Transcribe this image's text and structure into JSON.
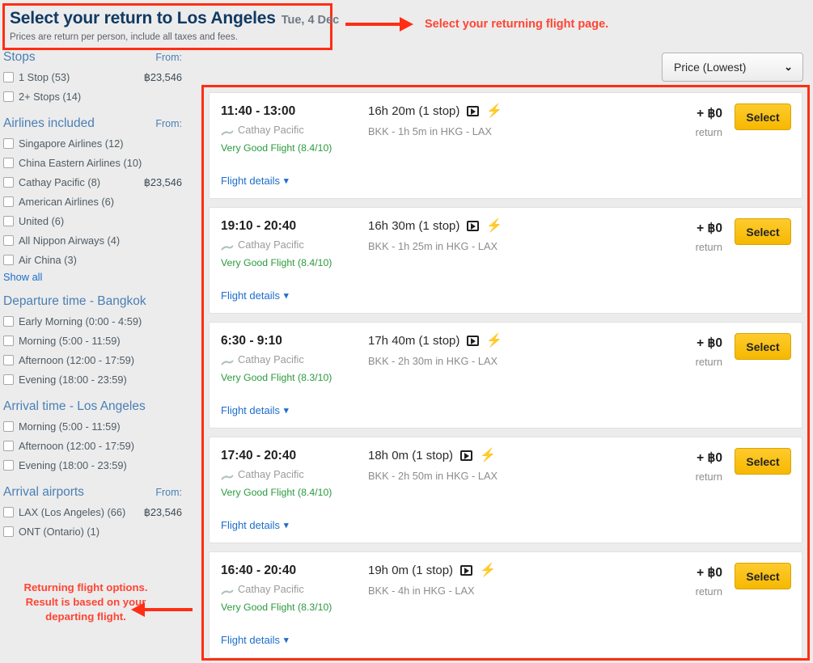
{
  "header": {
    "title": "Select your return to Los Angeles",
    "date": "Tue, 4 Dec",
    "subtitle": "Prices are return per person, include all taxes and fees."
  },
  "annotations": {
    "top": "Select your returning flight page.",
    "left": "Returning flight options. Result is based on your departing flight.",
    "box_color": "#ff2e14",
    "text_color": "#ff4433"
  },
  "sort": {
    "label": "Price (Lowest)",
    "chevron": "chevron-down-icon"
  },
  "sidebar": {
    "groups": [
      {
        "title": "Stops",
        "from_label": "From:",
        "options": [
          {
            "label": "1 Stop (53)",
            "price": "฿23,546",
            "checked": false
          },
          {
            "label": "2+ Stops (14)",
            "price": "",
            "checked": false
          }
        ]
      },
      {
        "title": "Airlines included",
        "from_label": "From:",
        "options": [
          {
            "label": "Singapore Airlines (12)",
            "price": "",
            "checked": false
          },
          {
            "label": "China Eastern Airlines (10)",
            "price": "",
            "checked": false
          },
          {
            "label": "Cathay Pacific (8)",
            "price": "฿23,546",
            "checked": false
          },
          {
            "label": "American Airlines (6)",
            "price": "",
            "checked": false
          },
          {
            "label": "United (6)",
            "price": "",
            "checked": false
          },
          {
            "label": "All Nippon Airways (4)",
            "price": "",
            "checked": false
          },
          {
            "label": "Air China (3)",
            "price": "",
            "checked": false
          }
        ],
        "show_all": "Show all"
      },
      {
        "title": "Departure time - Bangkok",
        "from_label": "",
        "options": [
          {
            "label": "Early Morning (0:00 - 4:59)",
            "price": "",
            "checked": false
          },
          {
            "label": "Morning (5:00 - 11:59)",
            "price": "",
            "checked": false
          },
          {
            "label": "Afternoon (12:00 - 17:59)",
            "price": "",
            "checked": false
          },
          {
            "label": "Evening (18:00 - 23:59)",
            "price": "",
            "checked": false
          }
        ]
      },
      {
        "title": "Arrival time - Los Angeles",
        "from_label": "",
        "options": [
          {
            "label": "Morning (5:00 - 11:59)",
            "price": "",
            "checked": false
          },
          {
            "label": "Afternoon (12:00 - 17:59)",
            "price": "",
            "checked": false
          },
          {
            "label": "Evening (18:00 - 23:59)",
            "price": "",
            "checked": false
          }
        ]
      },
      {
        "title": "Arrival airports",
        "from_label": "From:",
        "options": [
          {
            "label": "LAX (Los Angeles) (66)",
            "price": "฿23,546",
            "checked": false
          },
          {
            "label": "ONT (Ontario) (1)",
            "price": "",
            "checked": false
          }
        ]
      }
    ]
  },
  "results": {
    "select_label": "Select",
    "details_label": "Flight details",
    "details_chevron": "chevron-down-icon",
    "return_label": "return",
    "icons": [
      "entertainment-screen-icon",
      "power-outlet-icon"
    ],
    "flights": [
      {
        "times": "11:40 - 13:00",
        "airline": "Cathay Pacific",
        "rating": "Very Good Flight (8.4/10)",
        "duration": "16h 20m (1 stop)",
        "route": "BKK - 1h 5m in HKG - LAX",
        "price": "+ ฿0"
      },
      {
        "times": "19:10 - 20:40",
        "airline": "Cathay Pacific",
        "rating": "Very Good Flight (8.4/10)",
        "duration": "16h 30m (1 stop)",
        "route": "BKK - 1h 25m in HKG - LAX",
        "price": "+ ฿0"
      },
      {
        "times": "6:30 - 9:10",
        "airline": "Cathay Pacific",
        "rating": "Very Good Flight (8.3/10)",
        "duration": "17h 40m (1 stop)",
        "route": "BKK - 2h 30m in HKG - LAX",
        "price": "+ ฿0"
      },
      {
        "times": "17:40 - 20:40",
        "airline": "Cathay Pacific",
        "rating": "Very Good Flight (8.4/10)",
        "duration": "18h 0m (1 stop)",
        "route": "BKK - 2h 50m in HKG - LAX",
        "price": "+ ฿0"
      },
      {
        "times": "16:40 - 20:40",
        "airline": "Cathay Pacific",
        "rating": "Very Good Flight (8.3/10)",
        "duration": "19h 0m (1 stop)",
        "route": "BKK - 4h in HKG - LAX",
        "price": "+ ฿0"
      }
    ]
  }
}
